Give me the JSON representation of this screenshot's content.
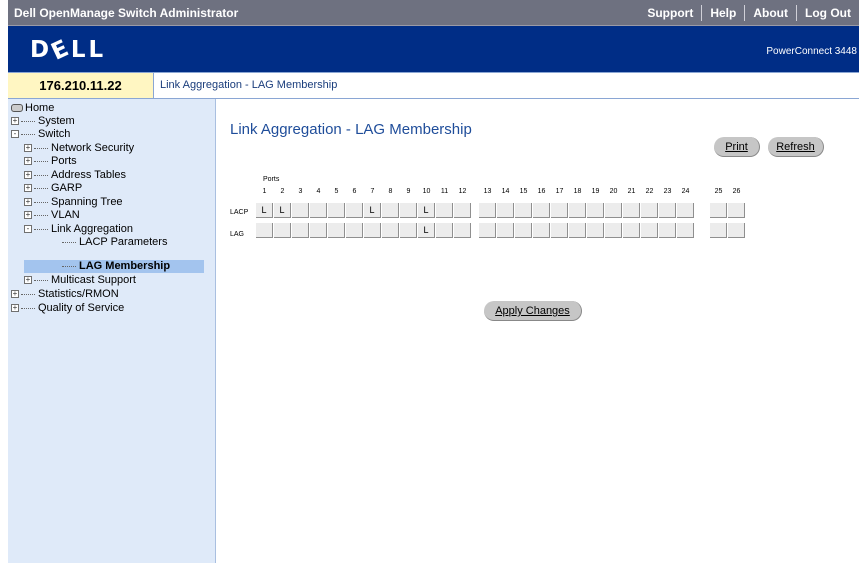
{
  "app": {
    "title": "Dell OpenManage Switch Administrator"
  },
  "topnav": {
    "support": "Support",
    "help": "Help",
    "about": "About",
    "logout": "Log Out"
  },
  "banner": {
    "logo": "DELL",
    "model": "PowerConnect 3448"
  },
  "info": {
    "ip": "176.210.11.22",
    "breadcrumb": "Link Aggregation - LAG Membership"
  },
  "tree": {
    "home": "Home",
    "system": "System",
    "switch": "Switch",
    "network_security": "Network Security",
    "ports": "Ports",
    "address_tables": "Address Tables",
    "garp": "GARP",
    "spanning_tree": "Spanning Tree",
    "vlan": "VLAN",
    "link_aggregation": "Link Aggregation",
    "lacp_parameters": "LACP Parameters",
    "lag_membership": "LAG Membership",
    "multicast_support": "Multicast Support",
    "statistics_rmon": "Statistics/RMON",
    "quality_of_service": "Quality of Service"
  },
  "page": {
    "title": "Link Aggregation - LAG Membership",
    "print": "Print",
    "refresh": "Refresh",
    "apply": "Apply Changes",
    "ports_label": "Ports",
    "lacp_label": "LACP",
    "lag_label": "LAG"
  },
  "ports": [
    "1",
    "2",
    "3",
    "4",
    "5",
    "6",
    "7",
    "8",
    "9",
    "10",
    "11",
    "12",
    "13",
    "14",
    "15",
    "16",
    "17",
    "18",
    "19",
    "20",
    "21",
    "22",
    "23",
    "24",
    "25",
    "26"
  ],
  "lacp_values": [
    "L",
    "L",
    "",
    "",
    "",
    "",
    "L",
    "",
    "",
    "L",
    "",
    "",
    "",
    "",
    "",
    "",
    "",
    "",
    "",
    "",
    "",
    "",
    "",
    "",
    "",
    ""
  ],
  "lag_values": [
    "",
    "",
    "",
    "",
    "",
    "",
    "",
    "",
    "",
    "L",
    "",
    "",
    "",
    "",
    "",
    "",
    "",
    "",
    "",
    "",
    "",
    "",
    "",
    "",
    "",
    ""
  ]
}
